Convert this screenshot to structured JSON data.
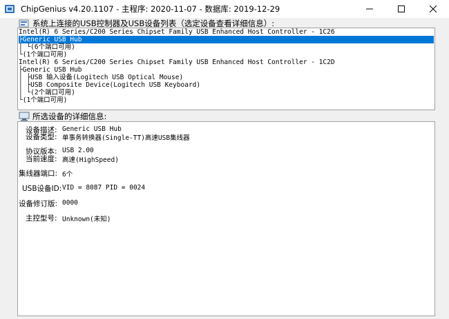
{
  "window": {
    "title": "ChipGenius v4.20.1107 - 主程序: 2020-11-07 - 数据库: 2019-12-29",
    "icons": {
      "app": "chipgenius-app-icon",
      "minimize": "minimize-icon",
      "maximize": "maximize-icon",
      "close": "close-icon"
    }
  },
  "device_list": {
    "label": "系统上连接的USB控制器及USB设备列表（选定设备查看详细信息）:",
    "icon": "usb-list-icon",
    "items": [
      "Intel(R) 6 Series/C200 Series Chipset Family USB Enhanced Host Controller - 1C26",
      "├Generic USB Hub",
      "│ └(6个端口可用)",
      "└(1个端口可用)",
      "Intel(R) 6 Series/C200 Series Chipset Family USB Enhanced Host Controller - 1C2D",
      "├Generic USB Hub",
      "│ ├USB 输入设备(Logitech USB Optical Mouse)",
      "│ ├USB Composite Device(Logitech USB Keyboard)",
      "│ └(2个端口可用)",
      "└(1个端口可用)"
    ],
    "selected_index": 1
  },
  "details": {
    "label": "所选设备的详细信息:",
    "icon": "device-details-icon",
    "rows": [
      {
        "label": "设备描述:",
        "value": "Generic USB Hub"
      },
      {
        "label": "设备类型:",
        "value": "单事务转换器(Single-TT)高速USB集线器"
      },
      {
        "label": "协议版本:",
        "value": "USB 2.00"
      },
      {
        "label": "当前速度:",
        "value": "高速(HighSpeed)"
      },
      {
        "label": "集线器端口:",
        "value": "6个"
      },
      {
        "label": "USB设备ID:",
        "value": "VID = 8087 PID = 0024"
      },
      {
        "label": "设备修订版:",
        "value": "0000"
      },
      {
        "label": "主控型号:",
        "value": "Unknown(未知)"
      }
    ]
  }
}
